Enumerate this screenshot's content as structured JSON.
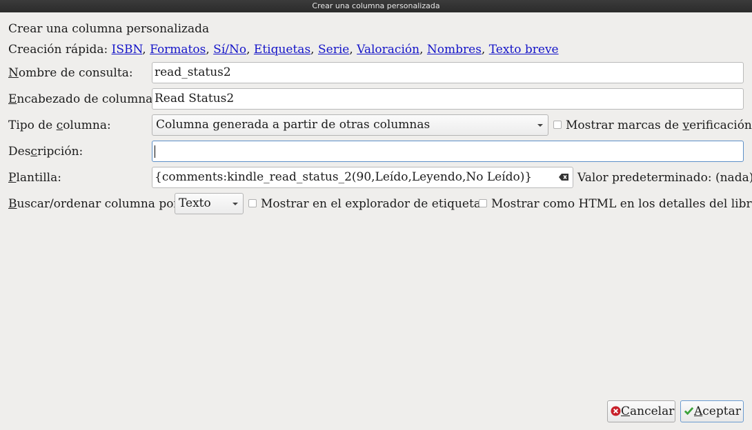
{
  "window": {
    "title": "Crear una columna personalizada"
  },
  "heading": "Crear una columna personalizada",
  "quick": {
    "label": "Creación rápida:",
    "links": [
      "ISBN",
      "Formatos",
      "Sí/No",
      "Etiquetas",
      "Serie",
      "Valoración",
      "Nombres",
      "Texto breve"
    ]
  },
  "lookup": {
    "label_key": "N",
    "label_rest": "ombre de consulta:",
    "value": "read_status2"
  },
  "header": {
    "label_key": "E",
    "label_rest": "ncabezado de columna:",
    "value": "Read Status2"
  },
  "coltype": {
    "label_pre": "Tipo de ",
    "label_key": "c",
    "label_rest": "olumna:",
    "value": "Columna generada a partir de otras columnas",
    "check_pre": "Mostrar marcas de ",
    "check_key": "v",
    "check_rest": "erificación"
  },
  "description": {
    "label_pre": "Des",
    "label_key": "c",
    "label_rest": "ripción:",
    "value": ""
  },
  "template": {
    "label_key": "P",
    "label_rest": "lantilla:",
    "value": "{comments:kindle_read_status_2(90,Leído,Leyendo,No Leído)}",
    "default_label": "Valor predeterminado: (nada)"
  },
  "sort": {
    "label_key": "B",
    "label_rest": "uscar/ordenar columna por",
    "value": "Texto",
    "tag_browser": "Mostrar en el explorador de etiquetas",
    "html_details": "Mostrar como HTML en los detalles del libro"
  },
  "buttons": {
    "cancel_key": "C",
    "cancel_rest": "ancelar",
    "ok_key": "A",
    "ok_rest": "ceptar"
  }
}
